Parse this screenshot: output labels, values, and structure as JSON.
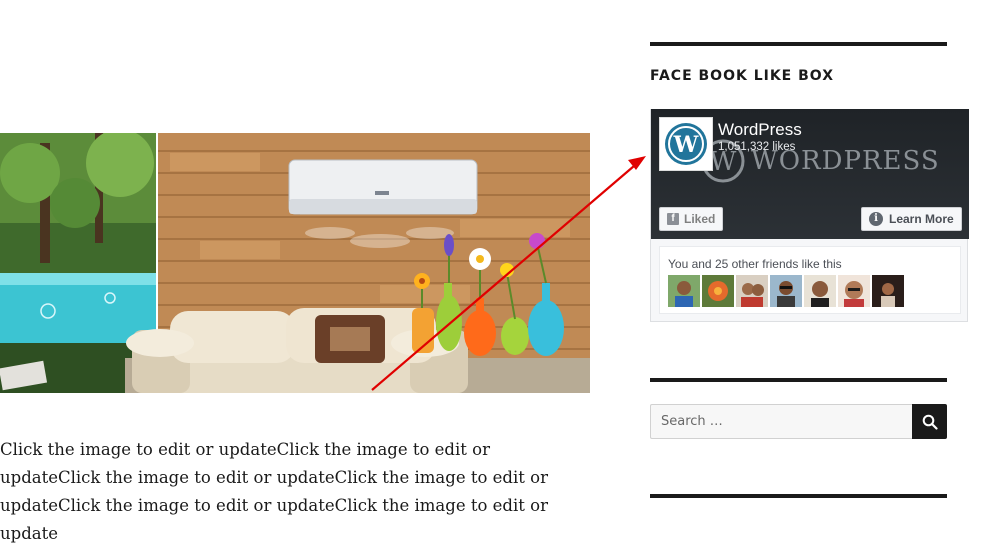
{
  "main": {
    "hero_alt": "Living room with air conditioner, sofa and flower vases",
    "body_text": "Click the image to edit or updateClick the image to edit or updateClick the image to edit or updateClick the image to edit or updateClick the image to edit or updateClick the image to edit or update"
  },
  "sidebar": {
    "facebook_widget": {
      "title": "FACE BOOK LIKE BOX",
      "page_name": "WordPress",
      "likes": "1,051,332 likes",
      "watermark": "WORDPRESS",
      "liked_label": "Liked",
      "learn_more_label": "Learn More",
      "friends_text": "You and 25 other friends like this",
      "friend_count_shown": 7
    },
    "search": {
      "placeholder": "Search …",
      "value": ""
    }
  },
  "colors": {
    "annotation_arrow": "#e00000",
    "fb_cover": "#23272b",
    "dark": "#1a1a1a"
  }
}
